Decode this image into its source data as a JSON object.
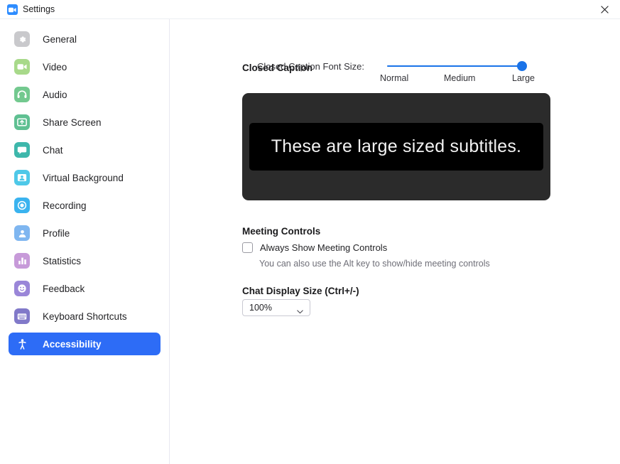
{
  "window": {
    "title": "Settings",
    "logo_icon": "zoom-camera-icon",
    "close_icon": "close-icon"
  },
  "sidebar": {
    "items": [
      {
        "label": "General",
        "icon": "gear-icon",
        "color": "#c9c9cc",
        "active": false
      },
      {
        "label": "Video",
        "icon": "video-camera-icon",
        "color": "#a8d98a",
        "active": false
      },
      {
        "label": "Audio",
        "icon": "headphones-icon",
        "color": "#73c98f",
        "active": false
      },
      {
        "label": "Share Screen",
        "icon": "share-screen-icon",
        "color": "#5fc092",
        "active": false
      },
      {
        "label": "Chat",
        "icon": "chat-bubble-icon",
        "color": "#3db7ab",
        "active": false
      },
      {
        "label": "Virtual Background",
        "icon": "person-frame-icon",
        "color": "#4ec8e8",
        "active": false
      },
      {
        "label": "Recording",
        "icon": "record-circle-icon",
        "color": "#3ab3ef",
        "active": false
      },
      {
        "label": "Profile",
        "icon": "person-icon",
        "color": "#7fb6f0",
        "active": false
      },
      {
        "label": "Statistics",
        "icon": "bar-chart-icon",
        "color": "#c79ad9",
        "active": false
      },
      {
        "label": "Feedback",
        "icon": "smiley-face-icon",
        "color": "#9a86d8",
        "active": false
      },
      {
        "label": "Keyboard Shortcuts",
        "icon": "keyboard-icon",
        "color": "#8179c9",
        "active": false
      },
      {
        "label": "Accessibility",
        "icon": "accessibility-person-icon",
        "color": "#2d6cf6",
        "active": true
      }
    ]
  },
  "main": {
    "closed_caption": {
      "section_title": "Closed Caption",
      "font_size_label": "Closed Caption Font Size:",
      "slider": {
        "value": "Large",
        "percent": 100,
        "ticks": [
          "Normal",
          "Medium",
          "Large"
        ]
      },
      "preview_text": "These are large sized subtitles."
    },
    "meeting_controls": {
      "section_title": "Meeting Controls",
      "checkbox_label": "Always Show Meeting Controls",
      "checkbox_checked": false,
      "hint": "You can also use the Alt key to show/hide meeting controls"
    },
    "chat_display_size": {
      "section_title": "Chat Display Size (Ctrl+/-)",
      "selected": "100%",
      "caret_icon": "chevron-down-icon"
    }
  },
  "colors": {
    "accent": "#2d6cf6",
    "slider": "#1a73e8",
    "preview_bg": "#2b2b2b",
    "caption_band": "#000000"
  }
}
